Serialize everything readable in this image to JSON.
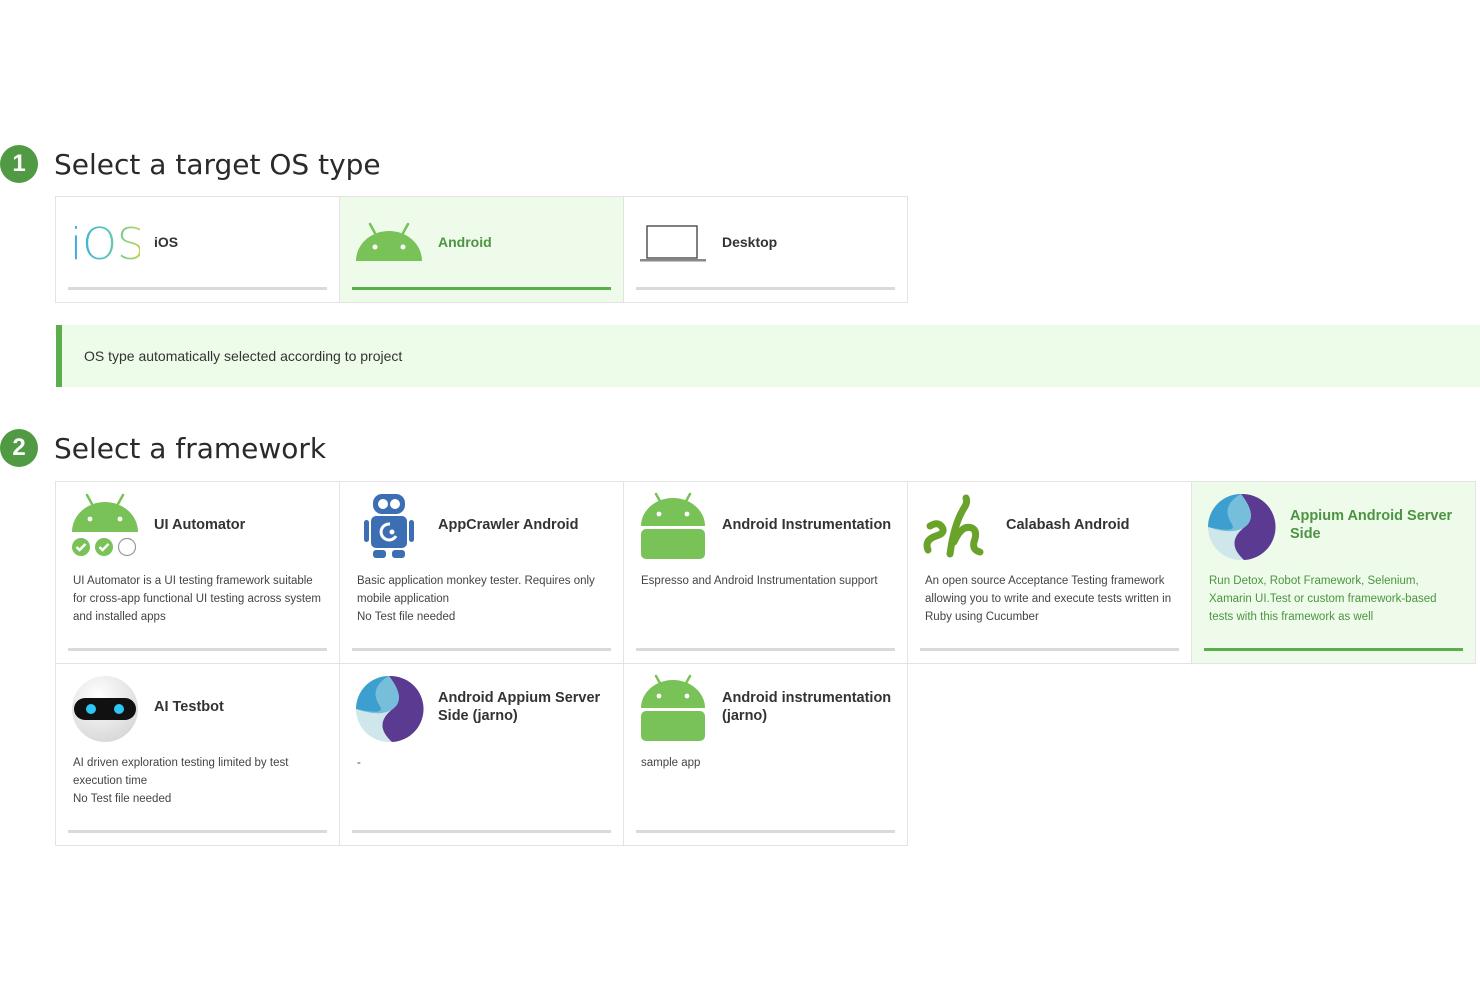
{
  "step1": {
    "number": "1",
    "title": "Select a target OS type"
  },
  "os_types": [
    {
      "name": "iOS",
      "logo_text": "iOS",
      "selected": false
    },
    {
      "name": "Android",
      "selected": true
    },
    {
      "name": "Desktop",
      "selected": false
    }
  ],
  "banner": {
    "text": "OS type automatically selected according to project"
  },
  "step2": {
    "number": "2",
    "title": "Select a framework"
  },
  "frameworks": [
    {
      "name": "UI Automator",
      "desc": "UI Automator is a UI testing framework suitable for cross-app functional UI testing across system and installed apps",
      "selected": false,
      "icon": "android-checks-icon"
    },
    {
      "name": "AppCrawler Android",
      "desc": "Basic application monkey tester. Requires only mobile application\nNo Test file needed",
      "selected": false,
      "icon": "robot-icon"
    },
    {
      "name": "Android Instrumentation",
      "desc": "Espresso and Android Instrumentation support",
      "selected": false,
      "icon": "android-icon"
    },
    {
      "name": "Calabash Android",
      "desc": "An open source Acceptance Testing framework allowing you to write and execute tests written in Ruby using Cucumber",
      "selected": false,
      "icon": "calabash-icon"
    },
    {
      "name": "Appium Android Server Side",
      "desc": "Run Detox, Robot Framework, Selenium, Xamarin UI.Test or custom framework-based tests with this framework as well",
      "selected": true,
      "icon": "appium-icon"
    },
    {
      "name": "AI Testbot",
      "desc": "AI driven exploration testing limited by test execution time\nNo Test file needed",
      "selected": false,
      "icon": "testbot-icon"
    },
    {
      "name": "Android Appium Server Side (jarno)",
      "desc": "-",
      "selected": false,
      "icon": "appium-icon"
    },
    {
      "name": "Android instrumentation (jarno)",
      "desc": "sample app",
      "selected": false,
      "icon": "android-icon"
    }
  ],
  "colors": {
    "accent": "#4f9a42",
    "selected_bg": "#eefbea",
    "android_green": "#78c257",
    "robot_blue": "#3b6eb3"
  }
}
